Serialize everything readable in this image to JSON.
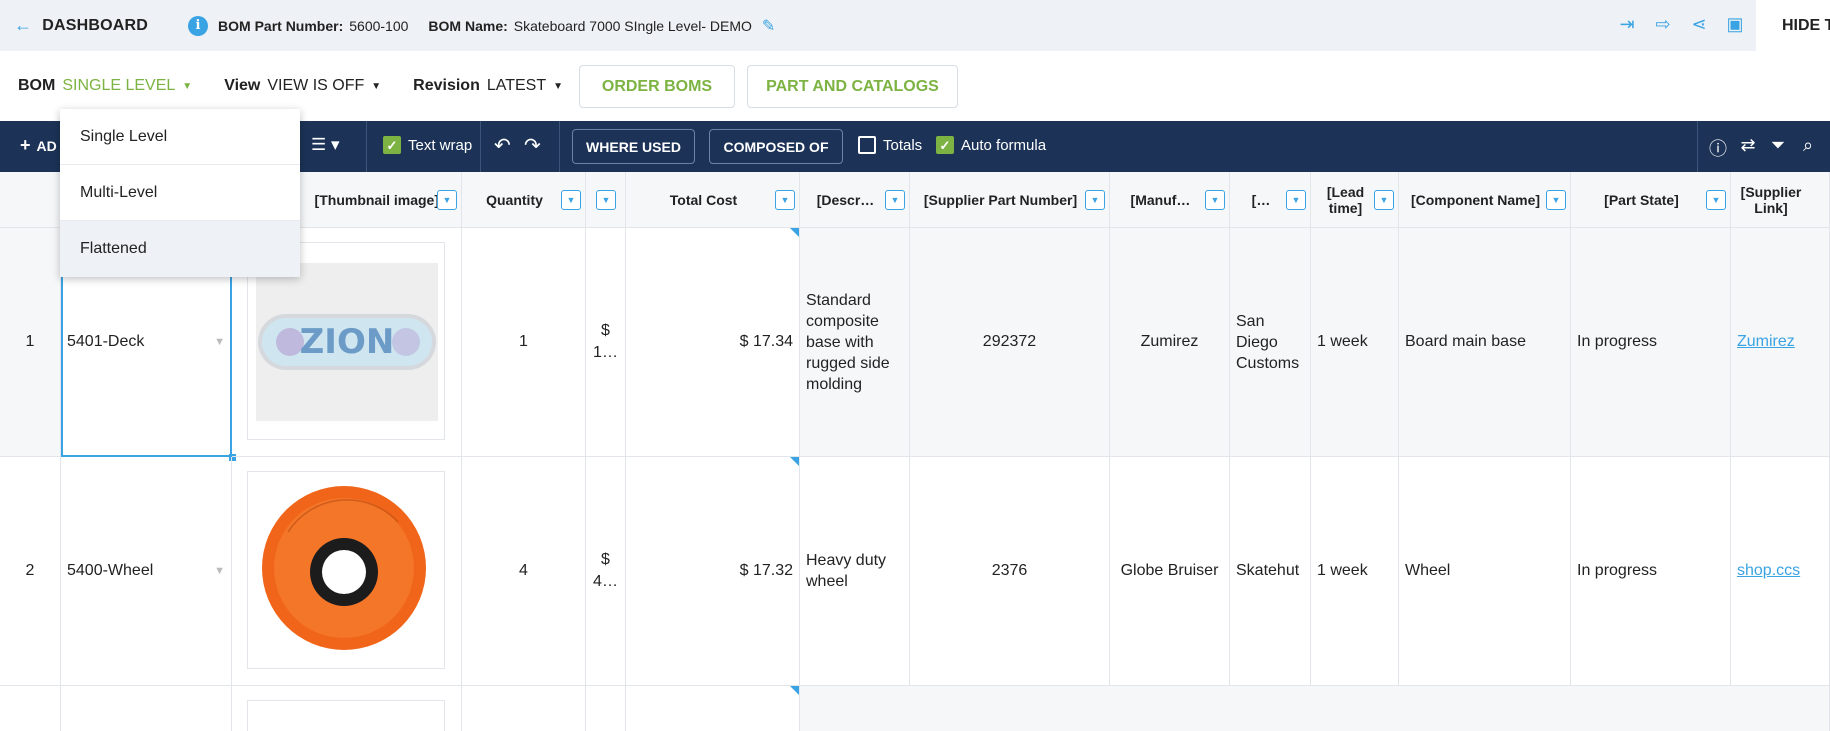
{
  "topbar": {
    "back_label": "DASHBOARD",
    "info_icon": "i",
    "part_number_label": "BOM Part Number:",
    "part_number": "5600-100",
    "bom_name_label": "BOM Name:",
    "bom_name": "Skateboard 7000 SIngle Level- DEMO",
    "hide_label": "HIDE T"
  },
  "controls": {
    "bom_label": "BOM",
    "bom_value": "SINGLE LEVEL",
    "view_label": "View",
    "view_value": "VIEW IS OFF",
    "revision_label": "Revision",
    "revision_value": "LATEST",
    "order_boms": "ORDER BOMS",
    "parts_catalogs": "PART AND CATALOGS"
  },
  "dropdown": {
    "items": [
      "Single Level",
      "Multi-Level",
      "Flattened"
    ]
  },
  "toolbar": {
    "add_label": "AD",
    "text_wrap": "Text wrap",
    "where_used": "WHERE USED",
    "composed_of": "COMPOSED OF",
    "totals": "Totals",
    "auto_formula": "Auto formula"
  },
  "columns": {
    "thumbnail": "[Thumbnail image]",
    "quantity": "Quantity",
    "total_cost": "Total Cost",
    "description": "[Descr…",
    "supplier_part": "[Supplier Part Number]",
    "manufacturer": "[Manuf…",
    "col_ellipsis": "[…",
    "lead_time": "[Lead time]",
    "component": "[Component Name]",
    "part_state": "[Part State]",
    "supplier_link": "[Supplier Link]"
  },
  "rows": [
    {
      "num": "1",
      "part": "5401-Deck",
      "qty": "1",
      "unit": "$ 1…",
      "total": "$ 17.34",
      "desc": "Standard composite base with rugged side molding",
      "supplier_part": "292372",
      "manufacturer": "Zumirez",
      "supplier": "San Diego Customs",
      "lead": "1 week",
      "component": "Board main base",
      "state": "In progress",
      "link": "Zumirez"
    },
    {
      "num": "2",
      "part": "5400-Wheel",
      "qty": "4",
      "unit": "$ 4…",
      "total": "$ 17.32",
      "desc": "Heavy duty wheel",
      "supplier_part": "2376",
      "manufacturer": "Globe Bruiser",
      "supplier": "Skatehut",
      "lead": "1 week",
      "component": "Wheel",
      "state": "In progress",
      "link": "shop.ccs"
    }
  ],
  "colors": {
    "accent": "#3aa3e3",
    "green": "#7cb342",
    "navy": "#1c3357"
  }
}
